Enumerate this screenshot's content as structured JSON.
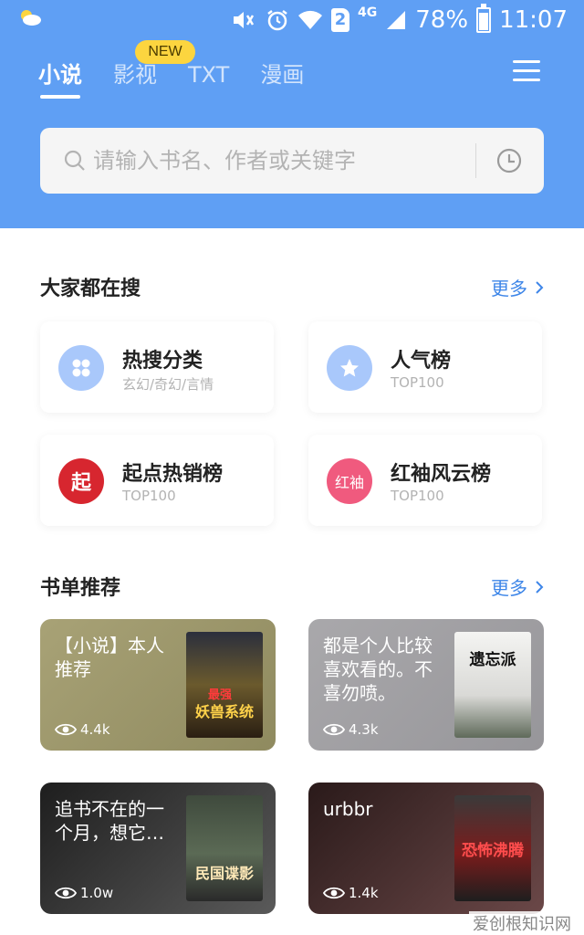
{
  "status_bar": {
    "battery": "78%",
    "time": "11:07",
    "sim": "2",
    "network": "4G"
  },
  "header": {
    "tabs": [
      {
        "label": "小说"
      },
      {
        "label": "影视"
      },
      {
        "label": "TXT"
      },
      {
        "label": "漫画"
      }
    ],
    "new_badge": "NEW"
  },
  "search": {
    "placeholder": "请输入书名、作者或关键字"
  },
  "hot_section": {
    "title": "大家都在搜",
    "more": "更多",
    "items": [
      {
        "title": "热搜分类",
        "sub": "玄幻/奇幻/言情",
        "icon": "grid-icon",
        "color": "#a9c8fb"
      },
      {
        "title": "人气榜",
        "sub": "TOP100",
        "icon": "star-icon",
        "color": "#a9c8fb"
      },
      {
        "title": "起点热销榜",
        "sub": "TOP100",
        "icon": "qidian-logo-icon",
        "icon_text": "起",
        "color": "#d7262f"
      },
      {
        "title": "红袖风云榜",
        "sub": "TOP100",
        "icon": "hongxiu-logo-icon",
        "icon_text": "红袖",
        "color": "#f05a7e"
      }
    ]
  },
  "booklist_section": {
    "title": "书单推荐",
    "more": "更多",
    "items": [
      {
        "text": "【小说】本人推荐",
        "views": "4.4k",
        "cover_title": "妖兽系统",
        "cover_top": "最强",
        "bg": "#9c9768"
      },
      {
        "text": "都是个人比较喜欢看的。不喜勿喷。",
        "views": "4.3k",
        "cover_title": "遗忘派",
        "bg": "#a2a1a4"
      },
      {
        "text": "追书不在的一个月，想它…",
        "views": "1.0w",
        "cover_title": "民国谍影",
        "bg": "#3a3a3a"
      },
      {
        "text": "urbbr",
        "views": "1.4k",
        "cover_title": "恐怖沸腾",
        "bg": "#4a2a2a"
      }
    ]
  },
  "watermark": "爱创根知识网"
}
